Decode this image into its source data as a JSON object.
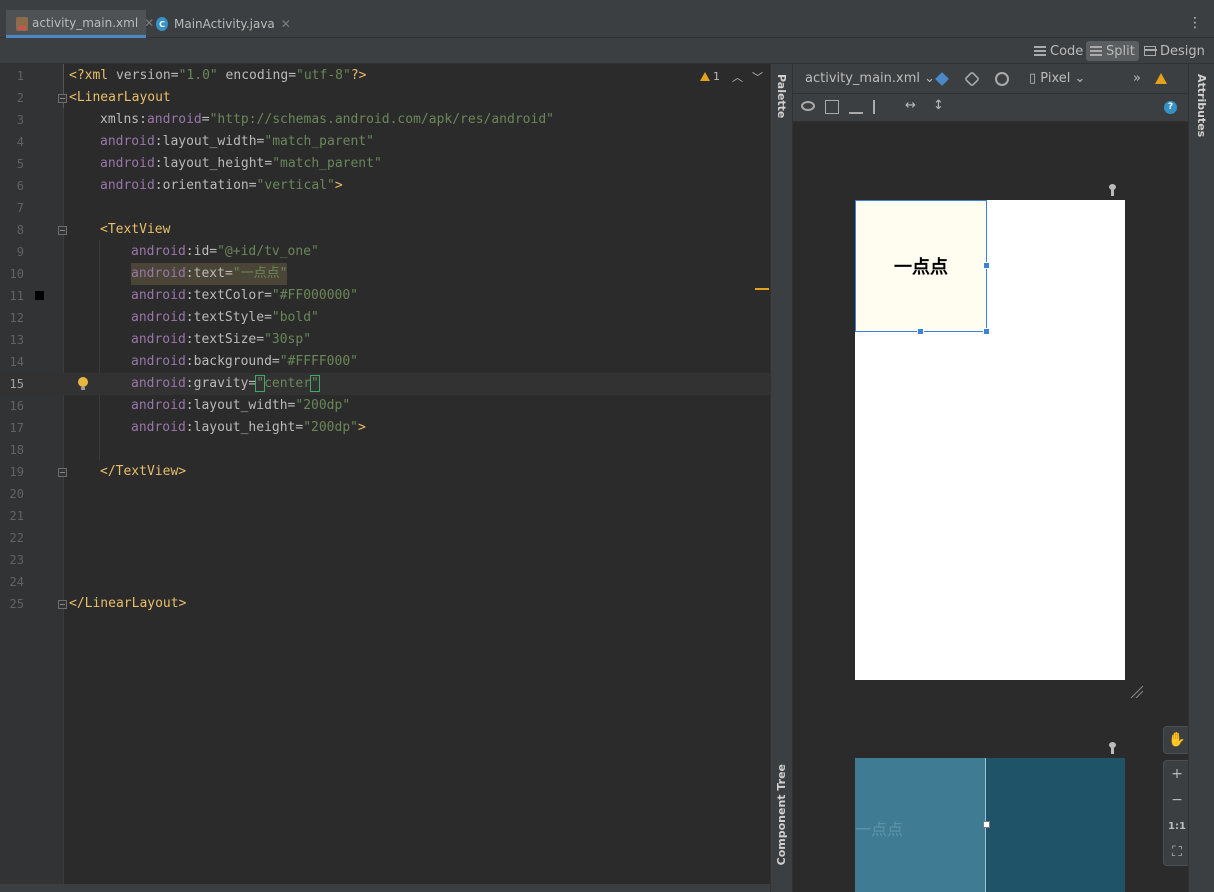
{
  "tabs": [
    {
      "label": "activity_main.xml",
      "icon": "xml-file-icon",
      "active": true
    },
    {
      "label": "MainActivity.java",
      "icon": "java-class-icon",
      "active": false
    }
  ],
  "modes": {
    "code": "Code",
    "split": "Split",
    "design": "Design",
    "selected": "Split"
  },
  "editor": {
    "warning_count": "1",
    "lines": [
      "1",
      "2",
      "3",
      "4",
      "5",
      "6",
      "7",
      "8",
      "9",
      "10",
      "11",
      "12",
      "13",
      "14",
      "15",
      "16",
      "17",
      "18",
      "19",
      "20",
      "21",
      "22",
      "23",
      "24",
      "25"
    ],
    "code": {
      "l1_open": "<?xml ",
      "l1_v": "version",
      "l1_eq1": "=",
      "l1_val1": "\"1.0\"",
      "l1_e": " encoding",
      "l1_eq2": "=",
      "l1_val2": "\"utf-8\"",
      "l1_close": "?>",
      "l2_tag": "<LinearLayout",
      "l3_attr": "xmlns:",
      "l3_ns": "android",
      "l3_eq": "=",
      "l3_val": "\"http://schemas.android.com/apk/res/android\"",
      "l4_ns": "android",
      "l4_attr": ":layout_width",
      "l4_eq": "=",
      "l4_val": "\"match_parent\"",
      "l5_ns": "android",
      "l5_attr": ":layout_height",
      "l5_eq": "=",
      "l5_val": "\"match_parent\"",
      "l6_ns": "android",
      "l6_attr": ":orientation",
      "l6_eq": "=",
      "l6_val": "\"vertical\"",
      "l6_close": ">",
      "l8_tag": "<TextView",
      "l9_ns": "android",
      "l9_attr": ":id",
      "l9_eq": "=",
      "l9_val": "\"@+id/tv_one\"",
      "l10_ns": "android",
      "l10_attr": ":text",
      "l10_eq": "=",
      "l10_val": "\"一点点\"",
      "l11_ns": "android",
      "l11_attr": ":textColor",
      "l11_eq": "=",
      "l11_val": "\"#FF000000\"",
      "l12_ns": "android",
      "l12_attr": ":textStyle",
      "l12_eq": "=",
      "l12_val": "\"bold\"",
      "l13_ns": "android",
      "l13_attr": ":textSize",
      "l13_eq": "=",
      "l13_val": "\"30sp\"",
      "l14_ns": "android",
      "l14_attr": ":background",
      "l14_eq": "=",
      "l14_val": "\"#FFFF000\"",
      "l15_ns": "android",
      "l15_attr": ":gravity",
      "l15_eq": "=",
      "l15_q1": "\"",
      "l15_val": "center",
      "l15_q2": "\"",
      "l16_ns": "android",
      "l16_attr": ":layout_width",
      "l16_eq": "=",
      "l16_val": "\"200dp\"",
      "l17_ns": "android",
      "l17_attr": ":layout_height",
      "l17_eq": "=",
      "l17_val": "\"200dp\"",
      "l17_close": ">",
      "l19_tag": "</TextView>",
      "l25_tag": "</LinearLayout>"
    }
  },
  "design": {
    "file_dropdown": "activity_main.xml",
    "device_dropdown": "Pixel",
    "palette_label": "Palette",
    "attributes_label": "Attributes",
    "component_tree_label": "Component Tree",
    "preview_text": "一点点",
    "blueprint_text": "一点点",
    "zoom": {
      "plus": "+",
      "minus": "−",
      "one_to_one": "1:1"
    },
    "colors": {
      "selection": "#3b83d8",
      "blueprint": "#1f5468",
      "warning": "#e3a21a"
    }
  }
}
